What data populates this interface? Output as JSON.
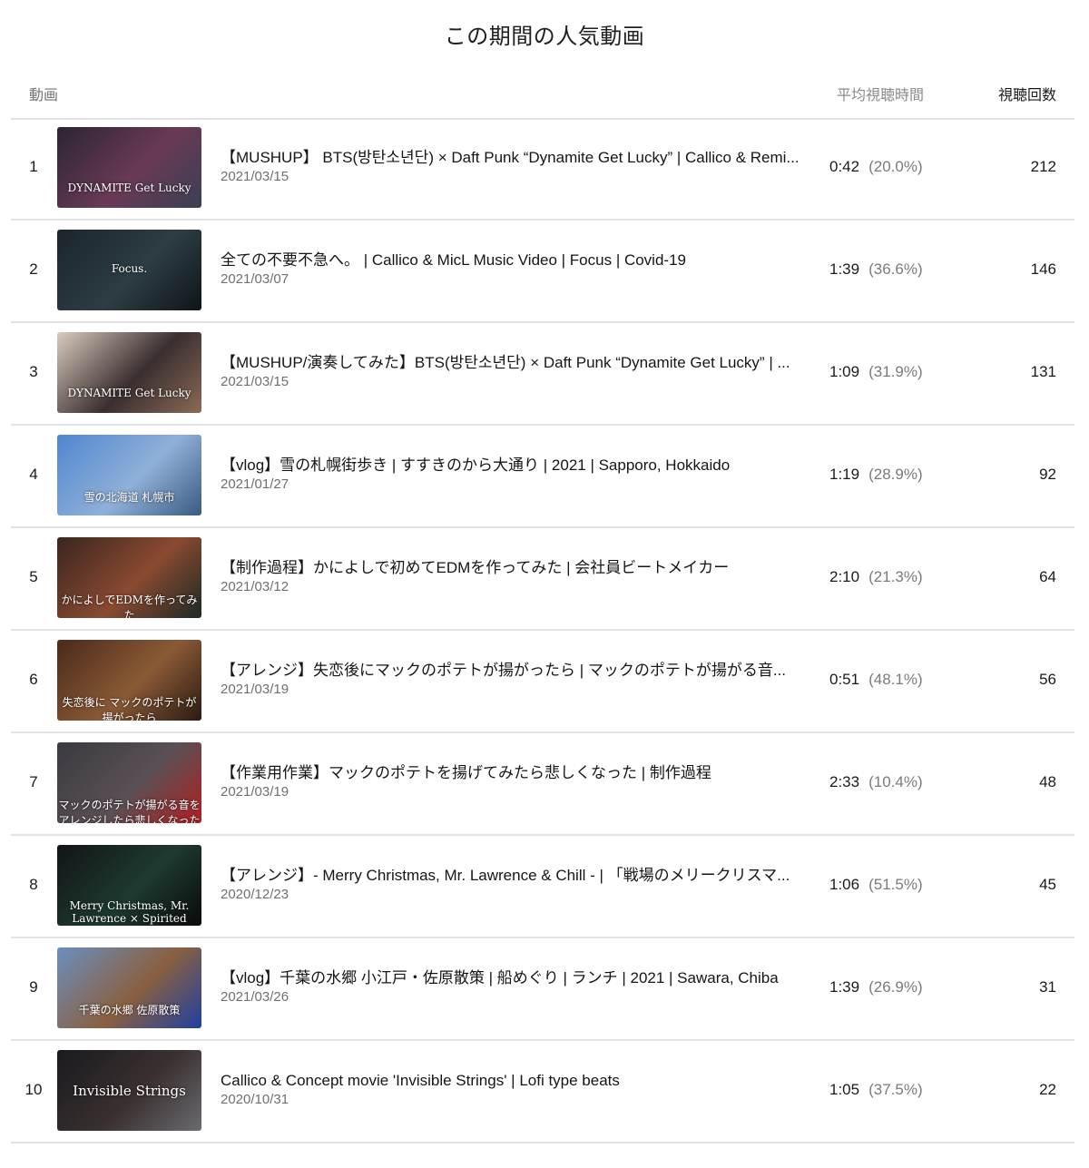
{
  "title": "この期間の人気動画",
  "columns": {
    "video": "動画",
    "avg_view_duration": "平均視聴時間",
    "views": "視聴回数"
  },
  "videos": [
    {
      "rank": "1",
      "title": "【MUSHUP】 BTS(방탄소년단) × Daft Punk “Dynamite Get Lucky” | Callico & Remi...",
      "date": "2021/03/15",
      "avg_duration": "0:42",
      "avg_percent": "(20.0%)",
      "views": "212",
      "thumb_text": "DYNAMITE Get Lucky",
      "thumb_colors": [
        "#2b2533",
        "#6a3a55",
        "#3a3f55"
      ]
    },
    {
      "rank": "2",
      "title": "全ての不要不急へ。 | Callico & MicL Music Video | Focus | Covid-19",
      "date": "2021/03/07",
      "avg_duration": "1:39",
      "avg_percent": "(36.6%)",
      "views": "146",
      "thumb_text": "Focus.",
      "thumb_colors": [
        "#1b262b",
        "#2d3d44",
        "#0f1518"
      ]
    },
    {
      "rank": "3",
      "title": "【MUSHUP/演奏してみた】BTS(방탄소년단) × Daft Punk “Dynamite Get Lucky” | ...",
      "date": "2021/03/15",
      "avg_duration": "1:09",
      "avg_percent": "(31.9%)",
      "views": "131",
      "thumb_text": "DYNAMITE Get Lucky",
      "thumb_colors": [
        "#d9cbbd",
        "#3a2e30",
        "#8a6a55"
      ]
    },
    {
      "rank": "4",
      "title": "【vlog】雪の札幌街歩き | すすきのから大通り | 2021 | Sapporo, Hokkaido",
      "date": "2021/01/27",
      "avg_duration": "1:19",
      "avg_percent": "(28.9%)",
      "views": "92",
      "thumb_text": "雪の北海道 札幌市",
      "thumb_colors": [
        "#4f86d0",
        "#8fb0d8",
        "#3c5a80"
      ]
    },
    {
      "rank": "5",
      "title": "【制作過程】かによしで初めてEDMを作ってみた | 会社員ビートメイカー",
      "date": "2021/03/12",
      "avg_duration": "2:10",
      "avg_percent": "(21.3%)",
      "views": "64",
      "thumb_text": "かによしでEDMを作ってみた",
      "thumb_colors": [
        "#3a2620",
        "#8a4a30",
        "#1d2a25"
      ]
    },
    {
      "rank": "6",
      "title": "【アレンジ】失恋後にマックのポテトが揚がったら | マックのポテトが揚がる音...",
      "date": "2021/03/19",
      "avg_duration": "0:51",
      "avg_percent": "(48.1%)",
      "views": "56",
      "thumb_text": "失恋後に マックのポテトが揚がったら",
      "thumb_colors": [
        "#4a2a1a",
        "#8a5a35",
        "#2a1a12"
      ]
    },
    {
      "rank": "7",
      "title": "【作業用作業】マックのポテトを揚げてみたら悲しくなった | 制作過程",
      "date": "2021/03/19",
      "avg_duration": "2:33",
      "avg_percent": "(10.4%)",
      "views": "48",
      "thumb_text": "マックのポテトが揚がる音を アレンジしたら悲しくなった",
      "thumb_colors": [
        "#3a3a40",
        "#5a5055",
        "#b02020"
      ]
    },
    {
      "rank": "8",
      "title": "【アレンジ】- Merry Christmas, Mr. Lawrence & Chill - | 「戦場のメリークリスマ...",
      "date": "2020/12/23",
      "avg_duration": "1:06",
      "avg_percent": "(51.5%)",
      "views": "45",
      "thumb_text": "Merry Christmas, Mr. Lawrence × Spirited Away",
      "thumb_colors": [
        "#121516",
        "#1e3a30",
        "#0a0a0a"
      ]
    },
    {
      "rank": "9",
      "title": "【vlog】千葉の水郷 小江戸・佐原散策 | 船めぐり | ランチ | 2021 | Sawara, Chiba",
      "date": "2021/03/26",
      "avg_duration": "1:39",
      "avg_percent": "(26.9%)",
      "views": "31",
      "thumb_text": "千葉の水郷 佐原散策",
      "thumb_colors": [
        "#6a8fc0",
        "#8a6040",
        "#2040a0"
      ]
    },
    {
      "rank": "10",
      "title": "Callico & Concept movie 'Invisible Strings' | Lofi type beats",
      "date": "2020/10/31",
      "avg_duration": "1:05",
      "avg_percent": "(37.5%)",
      "views": "22",
      "thumb_text": "Invisible Strings",
      "thumb_colors": [
        "#1a1a1e",
        "#3a3030",
        "#6a6a70"
      ]
    }
  ]
}
